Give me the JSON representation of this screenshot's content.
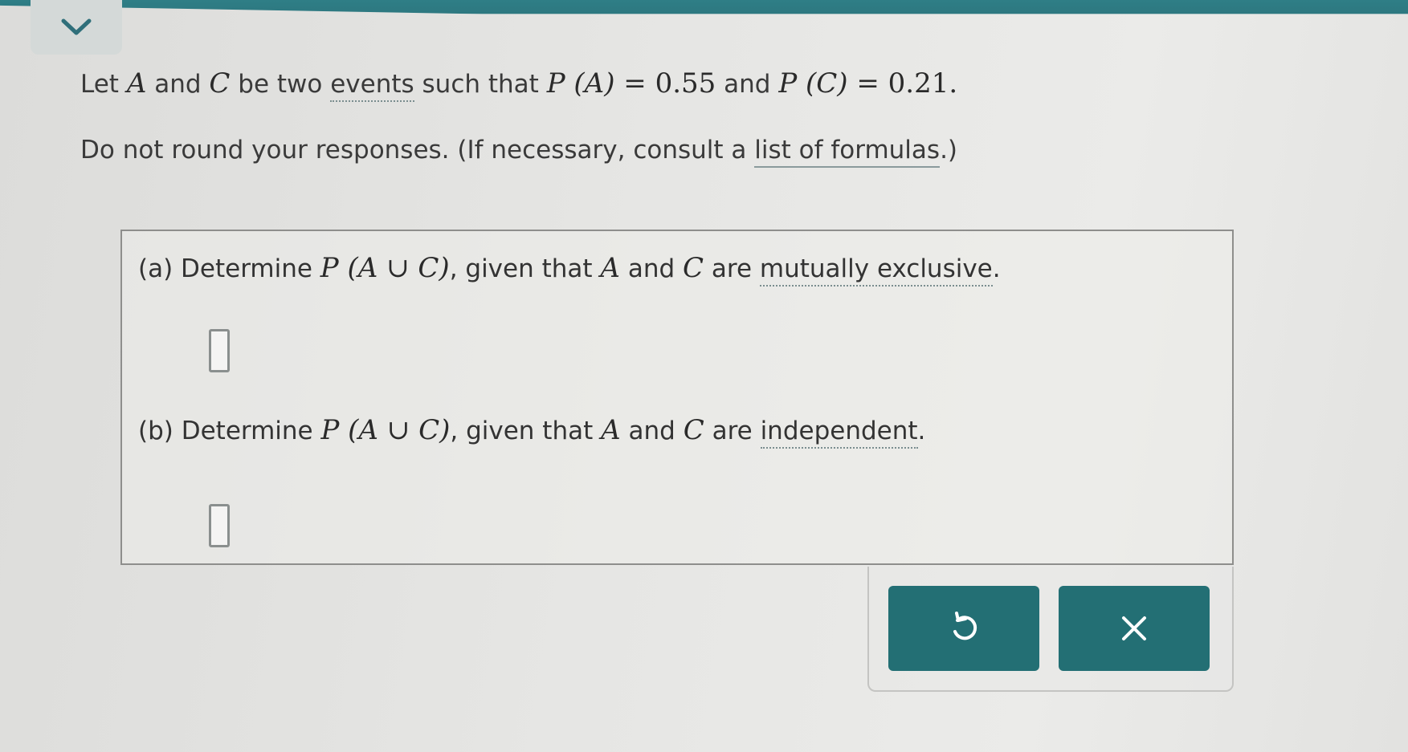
{
  "intro": {
    "line1_let": "Let ",
    "var_a": "A",
    "and_1": " and ",
    "var_c": "C",
    "be_two": " be two ",
    "events_link": "events",
    "such_that": " such that ",
    "pa_expr": "P (A)",
    "pa_val": " = 0.55",
    "and_2": " and ",
    "pc_expr": "P (C)",
    "pc_val": " = 0.21.",
    "line2_text": "Do not round your responses. (If necessary, consult a ",
    "formulas_link": "list of formulas",
    "line2_end": ".)"
  },
  "part_a": {
    "prefix": "(a)  Determine ",
    "expr": "P (A ∪ C)",
    "middle": ", given that ",
    "var_a": "A",
    "and": " and ",
    "var_c": "C",
    "are": " are ",
    "link": "mutually exclusive",
    "end": ".",
    "answer": ""
  },
  "part_b": {
    "prefix": "(b)  Determine ",
    "expr": "P (A ∪ C)",
    "middle": ", given that ",
    "var_a": "A",
    "and": " and ",
    "var_c": "C",
    "are": " are ",
    "link": "independent",
    "end": ".",
    "answer": ""
  },
  "buttons": {
    "undo_icon": "undo-arrow-icon",
    "clear_icon": "close-x-icon"
  },
  "colors": {
    "accent": "#236f74",
    "top_bar": "#2f7e86"
  }
}
